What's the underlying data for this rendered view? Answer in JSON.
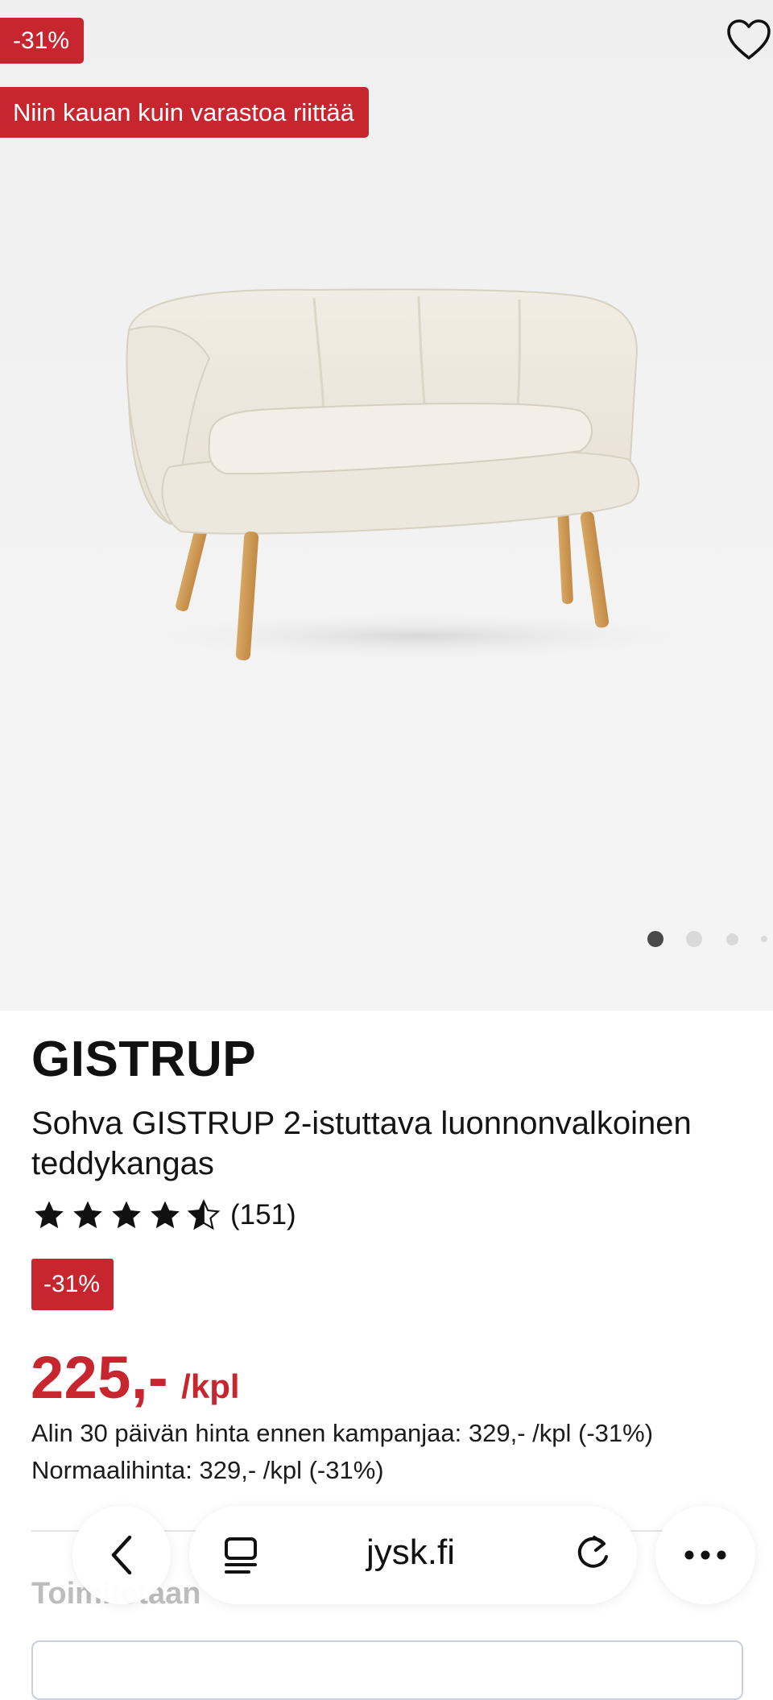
{
  "hero": {
    "discount_badge": "-31%",
    "stock_badge": "Niin kauan kuin varastoa riittää",
    "carousel_dots": 4,
    "carousel_active": 1
  },
  "product": {
    "brand": "GISTRUP",
    "name": "Sohva GISTRUP 2-istuttava luonnonvalkoinen teddykangas",
    "rating_value": 4.5,
    "rating_count": "(151)",
    "discount_badge": "-31%",
    "price": "225,-",
    "price_unit": "/kpl",
    "lowest_price_note": "Alin 30 päivän hinta ennen kampanjaa: 329,- /kpl (-31%)",
    "normal_price_note": "Normaalihinta: 329,- /kpl (-31%)"
  },
  "delivery": {
    "label": "Toimitetaan"
  },
  "browser": {
    "url": "jysk.fi",
    "icons": [
      "back-icon",
      "tabs-icon",
      "reload-icon",
      "more-icon"
    ]
  },
  "colors": {
    "accent_red": "#c8262f",
    "text": "#111111"
  }
}
